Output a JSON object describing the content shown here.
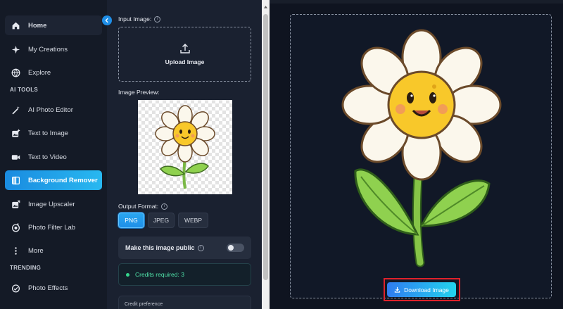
{
  "sidebar": {
    "items": [
      {
        "label": "Home",
        "icon": "home-icon"
      },
      {
        "label": "My Creations",
        "icon": "sparkle-icon"
      },
      {
        "label": "Explore",
        "icon": "globe-icon"
      },
      {
        "label": "AI Photo Editor",
        "icon": "magic-wand-icon"
      },
      {
        "label": "Text to Image",
        "icon": "image-plus-icon"
      },
      {
        "label": "Text to Video",
        "icon": "video-icon"
      },
      {
        "label": "Background Remover",
        "icon": "split-image-icon"
      },
      {
        "label": "Image Upscaler",
        "icon": "upscale-icon"
      },
      {
        "label": "Photo Filter Lab",
        "icon": "filter-icon"
      },
      {
        "label": "More",
        "icon": "more-vertical-icon"
      },
      {
        "label": "Photo Effects",
        "icon": "effects-icon"
      }
    ],
    "sections": {
      "ai_tools": "AI TOOLS",
      "trending": "TRENDING"
    },
    "active_item": "Background Remover"
  },
  "panel": {
    "input_label": "Input Image:",
    "upload_label": "Upload Image",
    "preview_label": "Image Preview:",
    "output_label": "Output Format:",
    "formats": [
      "PNG",
      "JPEG",
      "WEBP"
    ],
    "selected_format": "PNG",
    "public_label": "Make this image public",
    "public_enabled": false,
    "credits_text": "Credits required: 3",
    "credit_pref_label": "Credit preference"
  },
  "stage": {
    "download_label": "Download Image"
  },
  "colors": {
    "accent": "#1f8fe8",
    "download_gradient_start": "#2f7cf0",
    "download_gradient_end": "#22d3ee",
    "highlight_frame": "#e0212b",
    "credits_text": "#4fe0a8"
  }
}
